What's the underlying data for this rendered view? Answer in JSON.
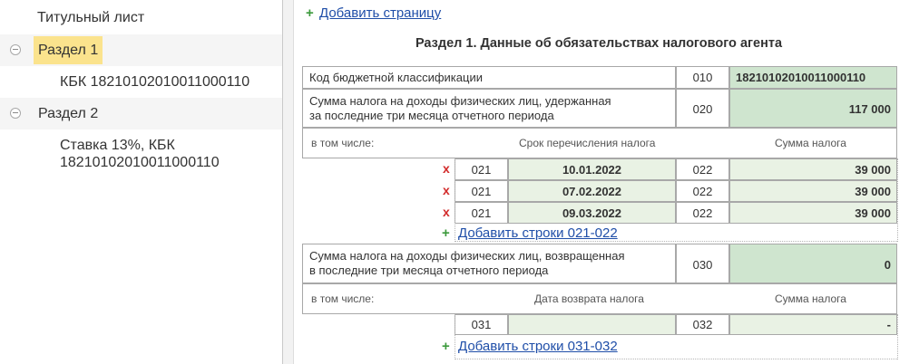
{
  "nav": {
    "title_page": "Титульный лист",
    "section1": {
      "label": "Раздел 1",
      "child": "КБК 18210102010011000110"
    },
    "section2": {
      "label": "Раздел 2",
      "child_line1": "Ставка 13%, КБК",
      "child_line2": "18210102010011000110"
    }
  },
  "toolbar": {
    "add_page": "Добавить страницу"
  },
  "form": {
    "title": "Раздел 1. Данные об обязательствах налогового агента",
    "kbk": {
      "label": "Код бюджетной классификации",
      "code": "010",
      "value": "18210102010011000110"
    },
    "withheld": {
      "label_line1": "Сумма налога на доходы физических лиц, удержанная",
      "label_line2": "за последние три месяца отчетного периода",
      "code": "020",
      "value": "117 000"
    },
    "including1": {
      "label": "в том числе:",
      "col1": "Срок перечисления налога",
      "col2": "Сумма налога"
    },
    "rows": [
      {
        "code1": "021",
        "date": "10.01.2022",
        "code2": "022",
        "amount": "39 000"
      },
      {
        "code1": "021",
        "date": "07.02.2022",
        "code2": "022",
        "amount": "39 000"
      },
      {
        "code1": "021",
        "date": "09.03.2022",
        "code2": "022",
        "amount": "39 000"
      }
    ],
    "add_rows_1": "Добавить строки 021-022",
    "returned": {
      "label_line1": "Сумма налога на доходы физических лиц, возвращенная",
      "label_line2": "в последние три месяца отчетного периода",
      "code": "030",
      "value": "0"
    },
    "including2": {
      "label": "в том числе:",
      "col1": "Дата возврата налога",
      "col2": "Сумма налога"
    },
    "return_row": {
      "code1": "031",
      "date": "",
      "code2": "032",
      "amount": "-"
    },
    "add_rows_2": "Добавить строки 031-032"
  },
  "icons": {
    "plus": "+",
    "delete": "x"
  },
  "colors": {
    "accent_link": "#1f4ea8",
    "selected_section": "#fbe38d",
    "input_green": "#cfe5cf",
    "delete_red": "#d22a2a",
    "plus_green": "#3c9a3c"
  }
}
